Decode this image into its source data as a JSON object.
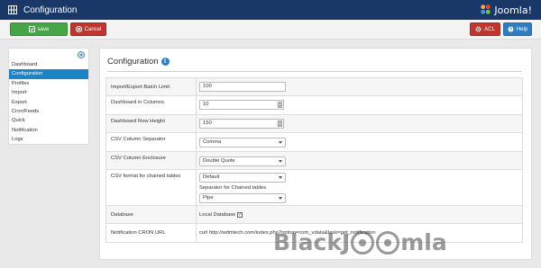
{
  "header": {
    "title": "Configuration",
    "brand": "Joomla!",
    "icons": {
      "page": "config-grid-icon",
      "brand": "joomla-logo-icon"
    }
  },
  "toolbar": {
    "save_label": "save",
    "cancel_label": "Cancel",
    "acl_label": "ACL",
    "help_label": "Help",
    "colors": {
      "save": "#46a546",
      "cancel": "#bd362f",
      "acl": "#bd362f",
      "help": "#2f7cc0"
    }
  },
  "sidebar": {
    "active": "Configuration",
    "items": [
      {
        "label": "Dashboard"
      },
      {
        "label": "Configuration"
      },
      {
        "label": "Profiles"
      },
      {
        "label": "Import"
      },
      {
        "label": "Export"
      },
      {
        "label": "Cron/Feeds"
      },
      {
        "label": "Quick"
      },
      {
        "label": "Notification"
      },
      {
        "label": "Logs"
      }
    ]
  },
  "main": {
    "title": "Configuration",
    "info_icon": "i",
    "fields": {
      "batch_limit": {
        "label": "Import/Export Batch Limit",
        "value": "100"
      },
      "dash_columns": {
        "label": "Dashboard in Columns",
        "value": "10"
      },
      "dash_row_height": {
        "label": "Dashboard Row Height",
        "value": "150"
      },
      "csv_separator": {
        "label": "CSV Column Separator",
        "value": "Comma"
      },
      "csv_enclosure": {
        "label": "CSV Column Enclosure",
        "value": "Double Quote"
      },
      "chained_format": {
        "label": "CSV format for chained tables",
        "value": "Default",
        "sub_label": "Separator for Chained tables",
        "sub_value": "Pipe"
      },
      "database": {
        "label": "Database",
        "value": "Local Database",
        "checked_glyph": "✓"
      },
      "cron_url": {
        "label": "Notification CRON URL",
        "value": "curl http://wdmtech.com/index.php?option=com_vdata&task=get_notification"
      }
    }
  },
  "watermark": {
    "text_a": "BlackJ",
    "text_b": "mla"
  }
}
